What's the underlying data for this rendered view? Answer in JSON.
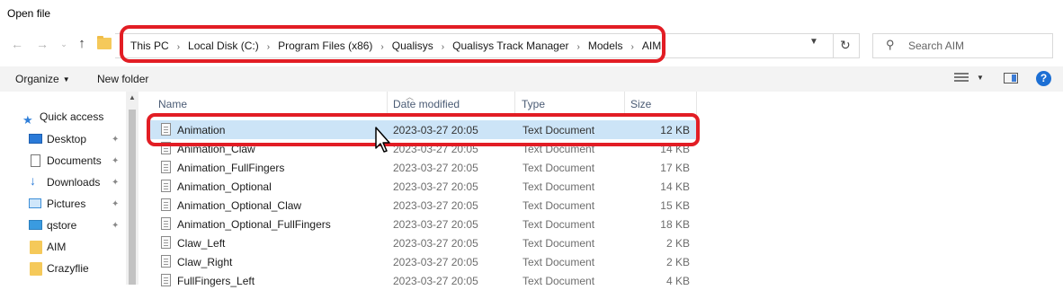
{
  "window": {
    "title": "Open file"
  },
  "nav": {
    "back": "←",
    "forward": "→",
    "recent": "⌄",
    "up": "↑"
  },
  "breadcrumb": [
    "This PC",
    "Local Disk (C:)",
    "Program Files (x86)",
    "Qualisys",
    "Qualisys Track Manager",
    "Models",
    "AIM"
  ],
  "search": {
    "placeholder": "Search AIM"
  },
  "toolbar": {
    "organize": "Organize",
    "new_folder": "New folder"
  },
  "sidebar": {
    "quick_access": "Quick access",
    "items": [
      {
        "label": "Desktop",
        "icon": "desktop-icon",
        "pinned": true
      },
      {
        "label": "Documents",
        "icon": "documents-icon",
        "pinned": true
      },
      {
        "label": "Downloads",
        "icon": "downloads-icon",
        "pinned": true
      },
      {
        "label": "Pictures",
        "icon": "pictures-icon",
        "pinned": true
      },
      {
        "label": "qstore",
        "icon": "pc-icon",
        "pinned": true
      },
      {
        "label": "AIM",
        "icon": "folder-icon",
        "pinned": false
      },
      {
        "label": "Crazyflie",
        "icon": "folder-icon",
        "pinned": false
      }
    ]
  },
  "columns": {
    "name": "Name",
    "date": "Date modified",
    "type": "Type",
    "size": "Size"
  },
  "files": [
    {
      "name": "Animation",
      "date": "2023-03-27 20:05",
      "type": "Text Document",
      "size": "12 KB",
      "selected": true
    },
    {
      "name": "Animation_Claw",
      "date": "2023-03-27 20:05",
      "type": "Text Document",
      "size": "14 KB"
    },
    {
      "name": "Animation_FullFingers",
      "date": "2023-03-27 20:05",
      "type": "Text Document",
      "size": "17 KB"
    },
    {
      "name": "Animation_Optional",
      "date": "2023-03-27 20:05",
      "type": "Text Document",
      "size": "14 KB"
    },
    {
      "name": "Animation_Optional_Claw",
      "date": "2023-03-27 20:05",
      "type": "Text Document",
      "size": "15 KB"
    },
    {
      "name": "Animation_Optional_FullFingers",
      "date": "2023-03-27 20:05",
      "type": "Text Document",
      "size": "18 KB"
    },
    {
      "name": "Claw_Left",
      "date": "2023-03-27 20:05",
      "type": "Text Document",
      "size": "2 KB"
    },
    {
      "name": "Claw_Right",
      "date": "2023-03-27 20:05",
      "type": "Text Document",
      "size": "2 KB"
    },
    {
      "name": "FullFingers_Left",
      "date": "2023-03-27 20:05",
      "type": "Text Document",
      "size": "4 KB"
    }
  ],
  "colors": {
    "highlight": "#e21d24",
    "selection": "#cce4f7",
    "accent": "#1c6fd4"
  }
}
